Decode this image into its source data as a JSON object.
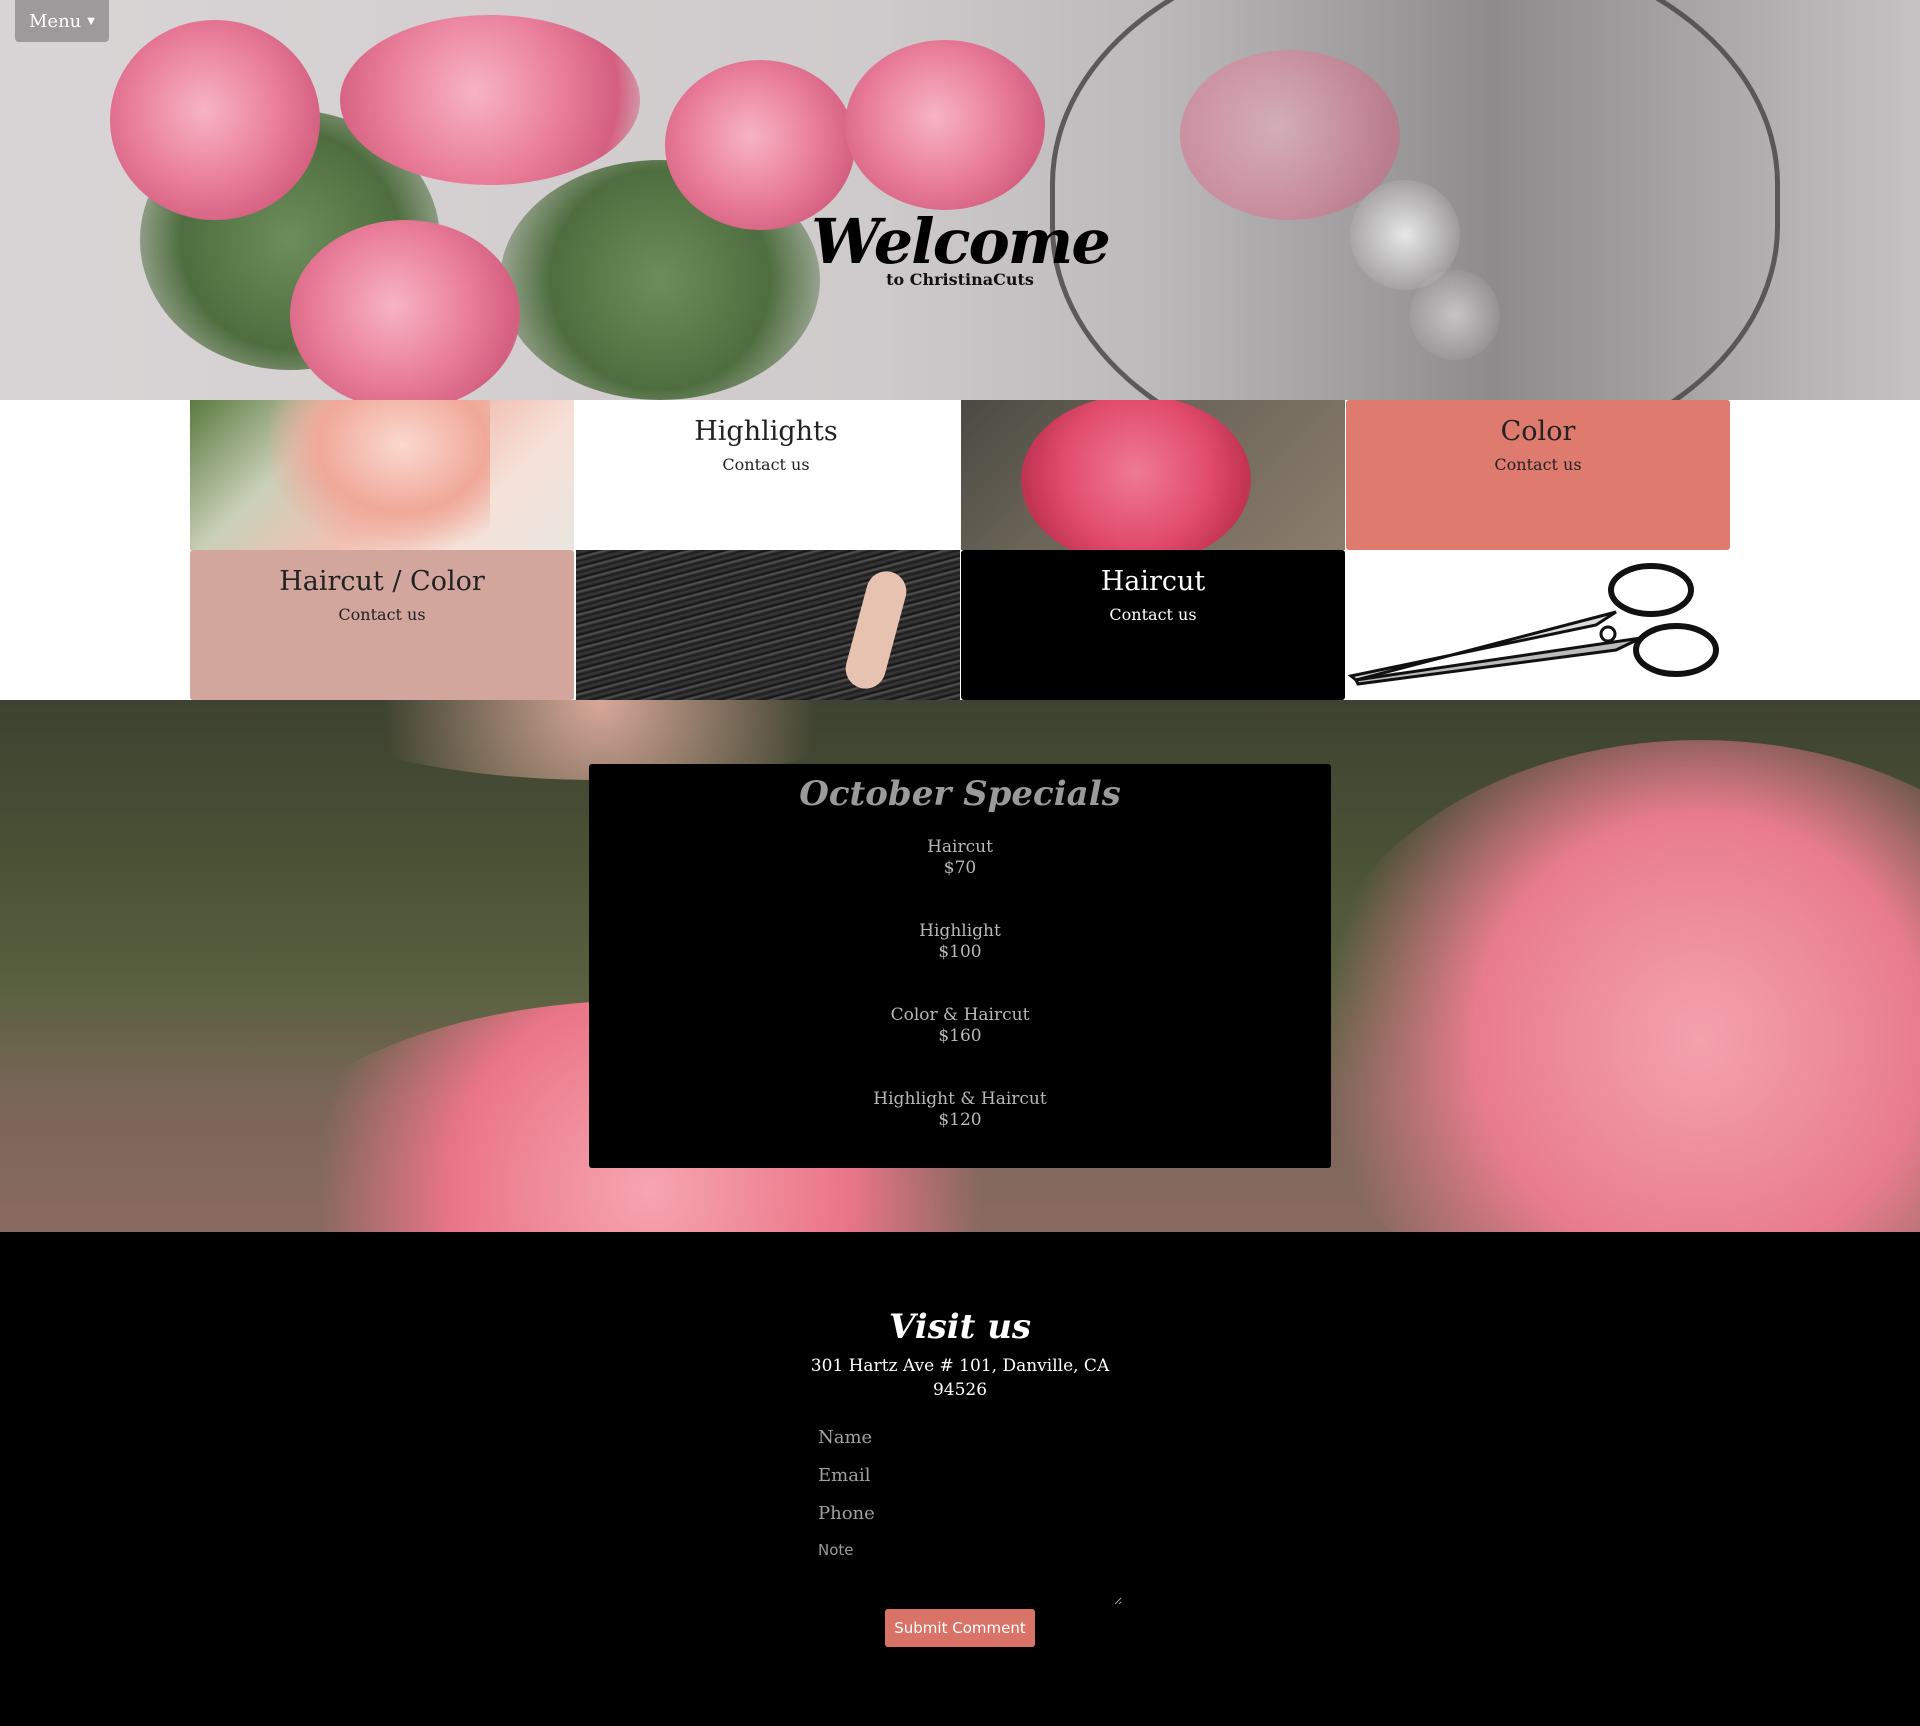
{
  "menu": {
    "label": "Menu"
  },
  "hero": {
    "title": "Welcome",
    "subtitle": "to ChristinaCuts"
  },
  "tiles": [
    {
      "title": "Highlights",
      "link": "Contact us"
    },
    {
      "title": "Color",
      "link": "Contact us"
    },
    {
      "title": "Haircut / Color",
      "link": "Contact us"
    },
    {
      "title": "Haircut",
      "link": "Contact us"
    }
  ],
  "specials": {
    "title": "October Specials",
    "items": [
      {
        "name": "Haircut",
        "price": "$70"
      },
      {
        "name": "Highlight",
        "price": "$100"
      },
      {
        "name": "Color & Haircut",
        "price": "$160"
      },
      {
        "name": "Highlight & Haircut",
        "price": "$120"
      }
    ]
  },
  "visit": {
    "title": "Visit us",
    "address_line1": "301 Hartz Ave # 101, Danville, CA",
    "address_line2": "94526",
    "form": {
      "name_placeholder": "Name",
      "email_placeholder": "Email",
      "phone_placeholder": "Phone",
      "note_placeholder": "Note",
      "submit_label": "Submit Comment"
    }
  },
  "colors": {
    "accent": "#d97368",
    "tile_color_bg": "#df7b6e",
    "tile_haircut_color_bg": "#d2a69c",
    "menu_bg": "#9c9a9b"
  }
}
